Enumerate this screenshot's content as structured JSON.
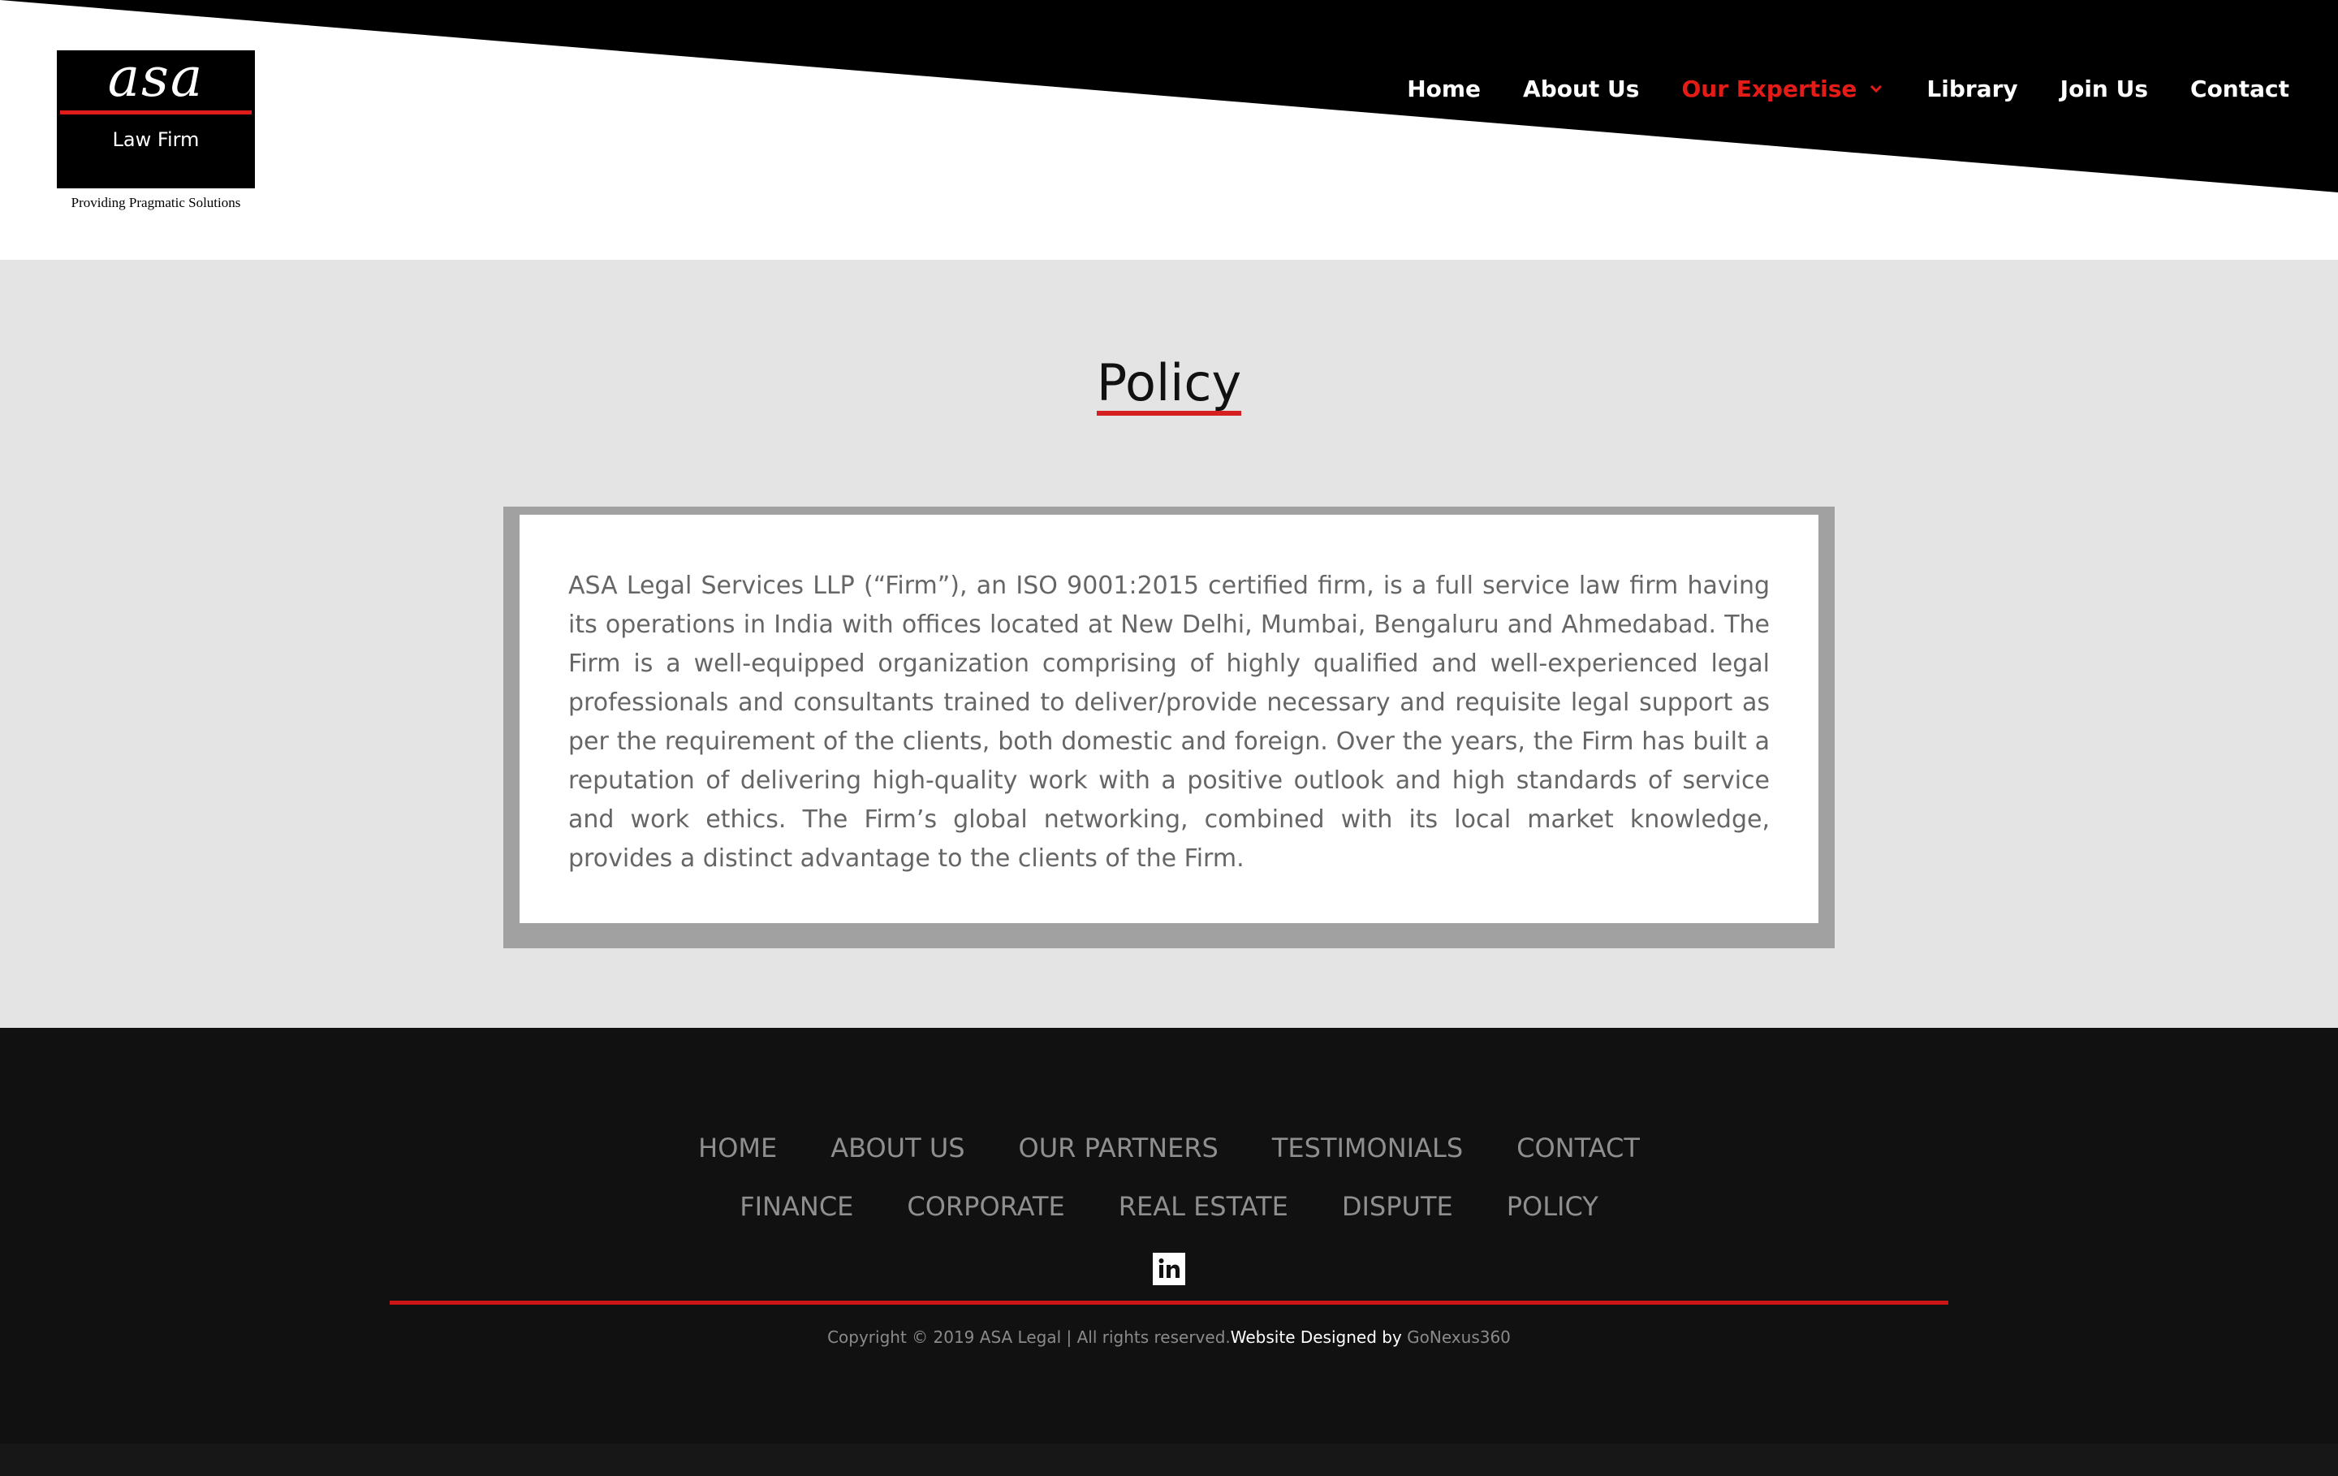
{
  "header": {
    "logo": {
      "mark": "asa",
      "subtitle": "Law Firm",
      "tagline": "Providing Pragmatic Solutions"
    },
    "nav": [
      {
        "label": "Home"
      },
      {
        "label": "About Us"
      },
      {
        "label": "Our Expertise",
        "active": true,
        "has_dropdown": true
      },
      {
        "label": "Library"
      },
      {
        "label": "Join Us"
      },
      {
        "label": "Contact"
      }
    ]
  },
  "main": {
    "title": "Policy",
    "body": "ASA Legal Services LLP (“Firm”), an ISO 9001:2015 certified firm, is a full service law firm having its operations in India with offices located at New Delhi, Mumbai, Bengaluru and Ahmedabad. The Firm is a well-equipped organization comprising of highly qualified and well-experienced legal professionals and consultants trained to deliver/provide necessary and requisite legal support as per the requirement of the clients, both domestic and foreign. Over the years, the Firm has built a reputation of delivering high-quality work with a positive outlook and high standards of service and work ethics. The Firm’s global networking, combined with its local market knowledge, provides a distinct advantage to the clients of the Firm."
  },
  "footer": {
    "links_row1": [
      "HOME",
      "ABOUT US",
      "OUR PARTNERS",
      "TESTIMONIALS",
      "CONTACT"
    ],
    "links_row2": [
      "FINANCE",
      "CORPORATE",
      "REAL ESTATE",
      "DISPUTE",
      "POLICY"
    ],
    "social_icon": "linkedin-icon",
    "copyright": "Copyright © 2019 ASA Legal | All rights reserved.",
    "designed_by": "Website Designed by ",
    "designer": "GoNexus360"
  },
  "colors": {
    "accent_red": "#e41b17",
    "header_black": "#000000",
    "main_bg": "#e4e4e4",
    "card_border": "#a1a1a1",
    "footer_bg": "#111111"
  }
}
